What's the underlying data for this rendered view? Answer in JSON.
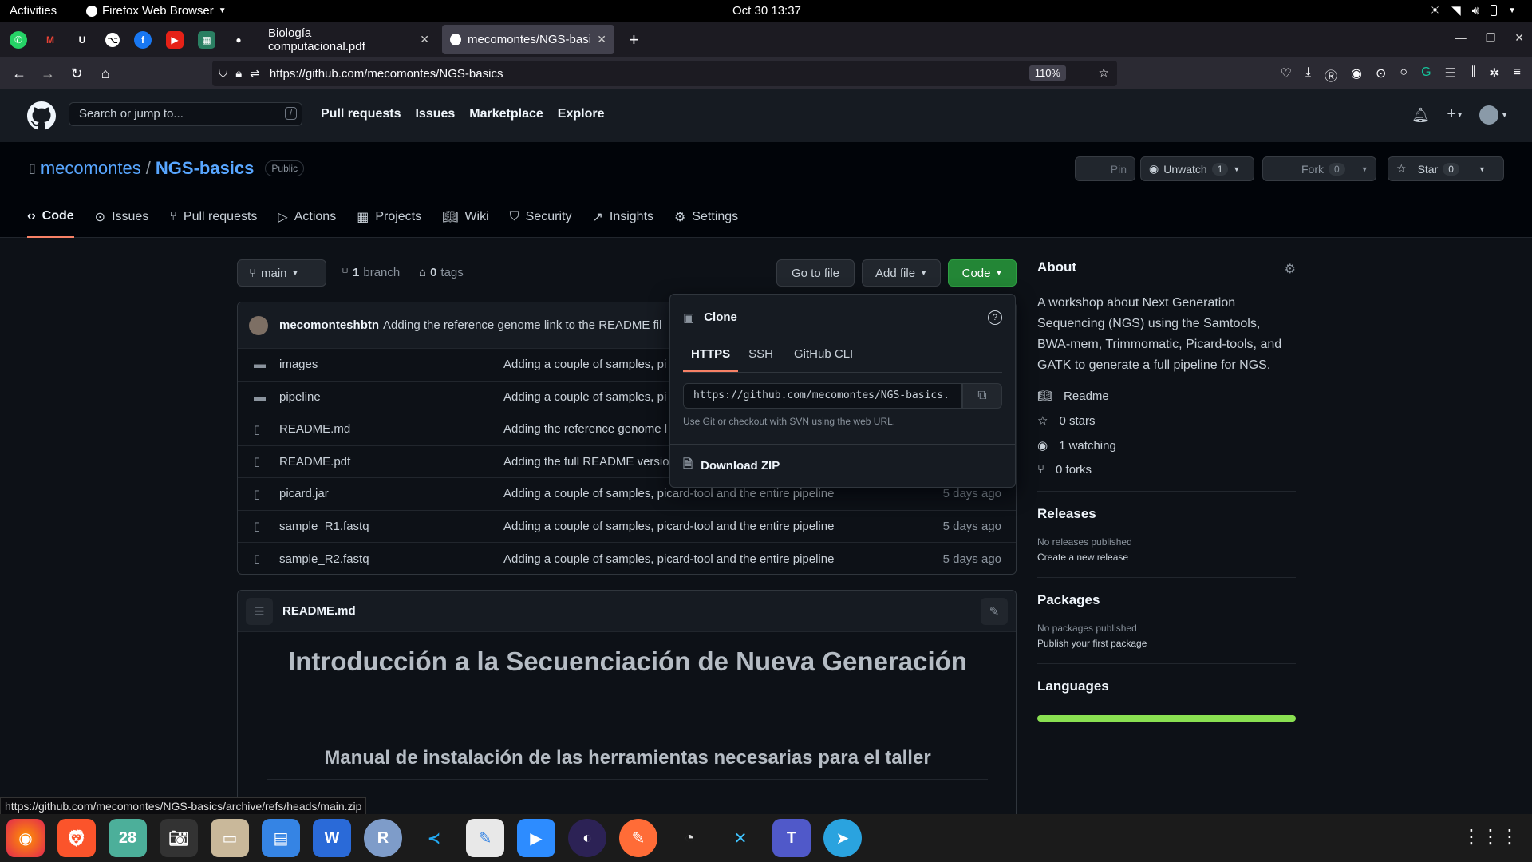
{
  "system": {
    "activities": "Activities",
    "browser": "Firefox Web Browser",
    "clock": "Oct 30  13:37"
  },
  "tabs": [
    {
      "label": "Biología computacional.pdf"
    },
    {
      "label": "mecomontes/NGS-basics"
    }
  ],
  "url": "https://github.com/mecomontes/NGS-basics",
  "zoom": "110%",
  "gh": {
    "search_placeholder": "Search or jump to...",
    "slash": "/",
    "nav": [
      "Pull requests",
      "Issues",
      "Marketplace",
      "Explore"
    ]
  },
  "repo": {
    "owner": "mecomontes",
    "sep": "/",
    "name": "NGS-basics",
    "visibility": "Public",
    "pin": "Pin",
    "unwatch": "Unwatch",
    "watch_count": "1",
    "fork": "Fork",
    "fork_count": "0",
    "star": "Star",
    "star_count": "0"
  },
  "repo_tabs": [
    "Code",
    "Issues",
    "Pull requests",
    "Actions",
    "Projects",
    "Wiki",
    "Security",
    "Insights",
    "Settings"
  ],
  "branch": {
    "name": "main",
    "branch_count": "1",
    "branch_label": "branch",
    "tag_count": "0",
    "tag_label": "tags",
    "go_to_file": "Go to file",
    "add_file": "Add file",
    "code": "Code"
  },
  "commit": {
    "author": "mecomonteshbtn",
    "message": "Adding the reference genome link to the README fil"
  },
  "files": [
    {
      "name": "images",
      "type": "dir",
      "message": "Adding a couple of samples, pi",
      "date": ""
    },
    {
      "name": "pipeline",
      "type": "dir",
      "message": "Adding a couple of samples, pi",
      "date": ""
    },
    {
      "name": "README.md",
      "type": "file",
      "message": "Adding the reference genome l",
      "date": ""
    },
    {
      "name": "README.pdf",
      "type": "file",
      "message": "Adding the full README versio",
      "date": ""
    },
    {
      "name": "picard.jar",
      "type": "file",
      "message": "Adding a couple of samples, picard-tool and the entire pipeline",
      "date": "5 days ago"
    },
    {
      "name": "sample_R1.fastq",
      "type": "file",
      "message": "Adding a couple of samples, picard-tool and the entire pipeline",
      "date": "5 days ago"
    },
    {
      "name": "sample_R2.fastq",
      "type": "file",
      "message": "Adding a couple of samples, picard-tool and the entire pipeline",
      "date": "5 days ago"
    }
  ],
  "clone": {
    "title": "Clone",
    "tabs": [
      "HTTPS",
      "SSH",
      "GitHub CLI"
    ],
    "url": "https://github.com/mecomontes/NGS-basics.",
    "hint": "Use Git or checkout with SVN using the web URL.",
    "download": "Download ZIP"
  },
  "readme": {
    "filename": "README.md",
    "h1": "Introducción a la Secuenciación de Nueva Generación",
    "h2": "Manual de instalación de las herramientas necesarias para el taller"
  },
  "about": {
    "title": "About",
    "description": "A workshop about Next Generation Sequencing (NGS) using the Samtools, BWA-mem, Trimmomatic, Picard-tools, and GATK to generate a full pipeline for NGS.",
    "readme": "Readme",
    "stars": "0 stars",
    "watching": "1 watching",
    "forks": "0 forks"
  },
  "releases": {
    "title": "Releases",
    "none": "No releases published",
    "create": "Create a new release"
  },
  "packages": {
    "title": "Packages",
    "none": "No packages published",
    "publish": "Publish your first package"
  },
  "languages": {
    "title": "Languages"
  },
  "statusbar": "https://github.com/mecomontes/NGS-basics/archive/refs/heads/main.zip",
  "dock_calendar": "28",
  "colors": {
    "accent_green": "#238636",
    "link": "#58a6ff",
    "tab_underline": "#f78166"
  }
}
